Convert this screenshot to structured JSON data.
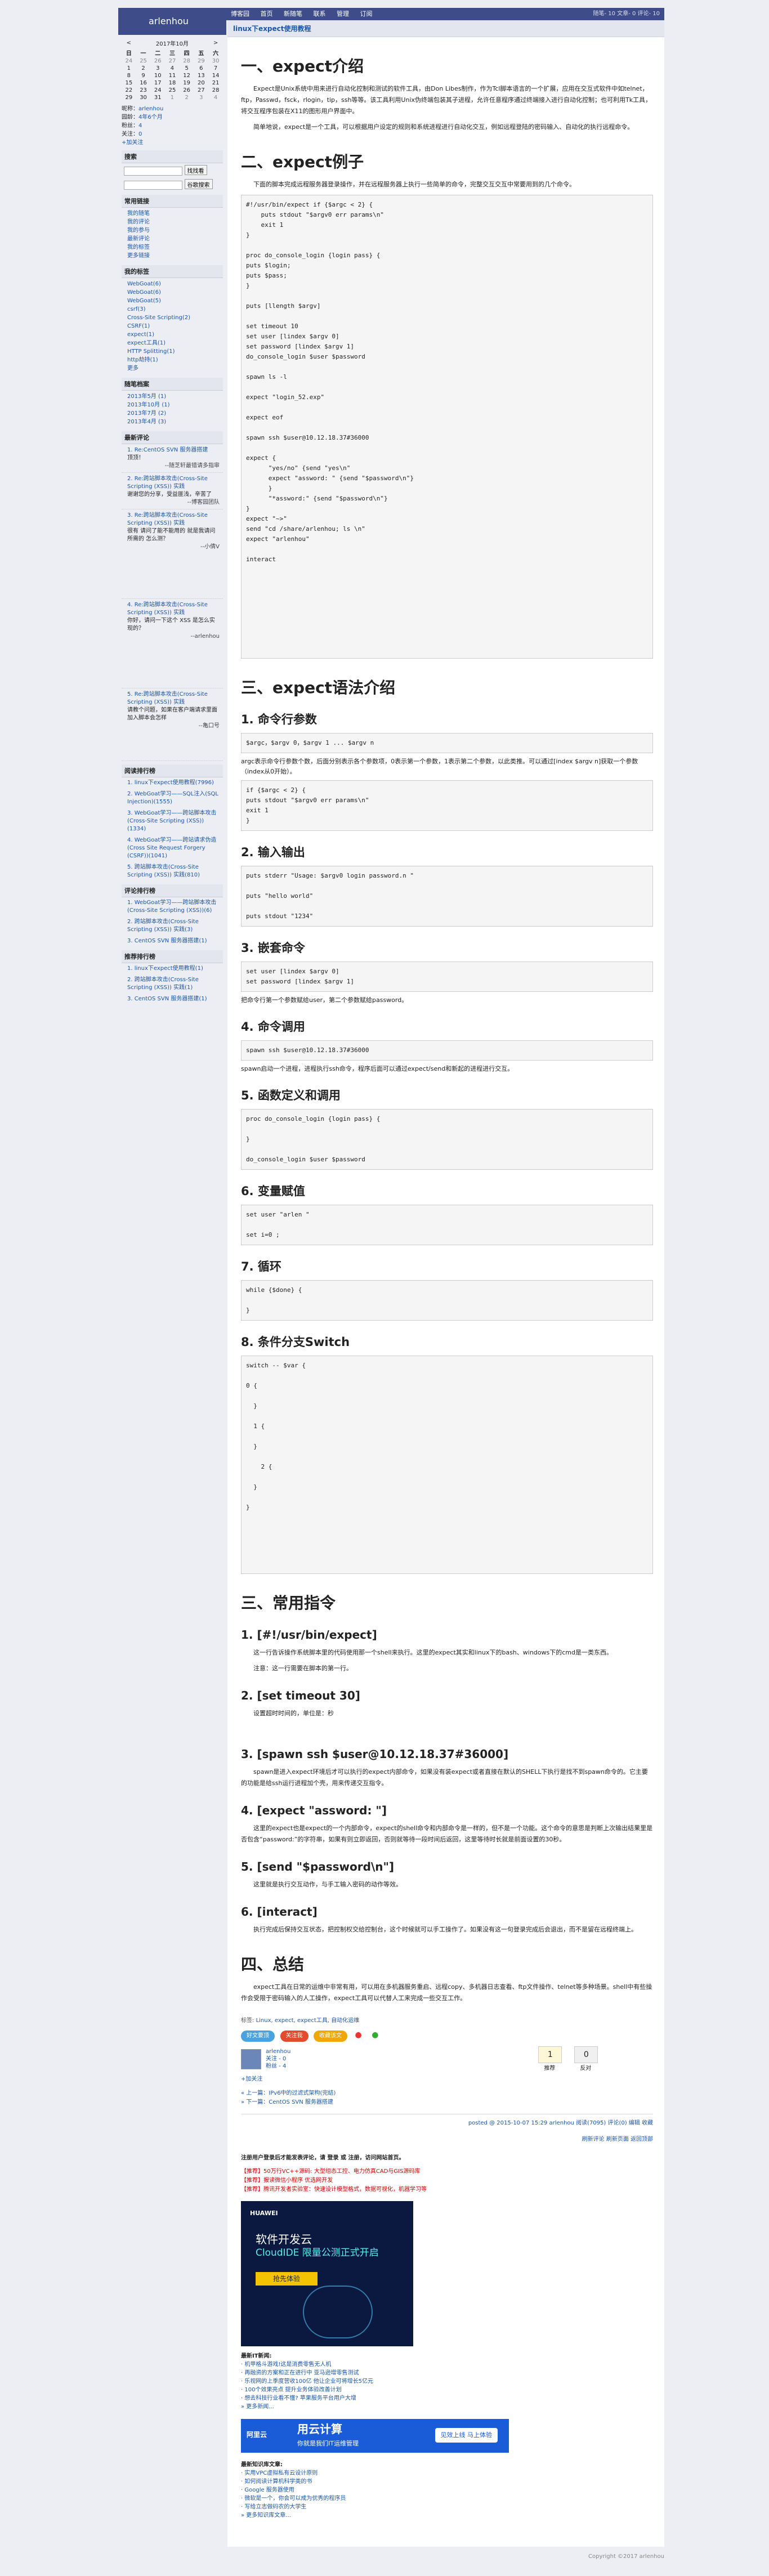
{
  "site": {
    "brand": "arlenhou",
    "nav": [
      "博客园",
      "首页",
      "新随笔",
      "联系",
      "管理",
      "订阅"
    ],
    "stats": "随笔- 10 文章- 0 评论- 10"
  },
  "calendar": {
    "prev": "<",
    "title": "2017年10月",
    "next": ">",
    "weekdays": [
      "日",
      "一",
      "二",
      "三",
      "四",
      "五",
      "六"
    ],
    "rows": [
      [
        "24",
        "25",
        "26",
        "27",
        "28",
        "29",
        "30"
      ],
      [
        "1",
        "2",
        "3",
        "4",
        "5",
        "6",
        "7"
      ],
      [
        "8",
        "9",
        "10",
        "11",
        "12",
        "13",
        "14"
      ],
      [
        "15",
        "16",
        "17",
        "18",
        "19",
        "20",
        "21"
      ],
      [
        "22",
        "23",
        "24",
        "25",
        "26",
        "27",
        "28"
      ],
      [
        "29",
        "30",
        "31",
        "1",
        "2",
        "3",
        "4"
      ]
    ]
  },
  "profile": {
    "nick_label": "昵称：",
    "nick": "arlenhou",
    "age_label": "园龄：",
    "age": "4年6个月",
    "fans_label": "粉丝：",
    "fans": "4",
    "follow_label": "关注：",
    "follow": "0",
    "add_follow": "+加关注"
  },
  "search": {
    "title": "搜索",
    "btn1": "找找看",
    "btn2": "谷歌搜索"
  },
  "links": {
    "title": "常用链接",
    "items": [
      "我的随笔",
      "我的评论",
      "我的参与",
      "最新评论",
      "我的标签",
      "更多链接"
    ]
  },
  "tags": {
    "title": "我的标签",
    "items": [
      "WebGoat(6)",
      "WebGoat(6)",
      "WebGoat(5)",
      "csrf(3)",
      "Cross-Site Scripting(2)",
      "CSRF(1)",
      "expect(1)",
      "expect工具(1)",
      "HTTP Splitting(1)",
      "http劫持(1)",
      "更多"
    ]
  },
  "archive": {
    "title": "随笔档案",
    "items": [
      "2013年5月 (1)",
      "2013年10月 (1)",
      "2013年7月 (2)",
      "2013年4月 (3)"
    ]
  },
  "recent_comments": {
    "title": "最新评论",
    "items": [
      {
        "link": "1. Re:CentOS SVN 服务器搭建",
        "text": "顶顶！",
        "by": "--随芝轩最错请多指审"
      },
      {
        "link": "2. Re:跨站脚本攻击(Cross-Site Scripting (XSS)) 实践",
        "text": "谢谢您的分享，受益匪浅，辛苦了",
        "by": "--博客园团队"
      },
      {
        "link": "3. Re:跨站脚本攻击(Cross-Site Scripting (XSS)) 实践",
        "text": "很有 请问了能不能用的 就是我请问所需的 怎么测？",
        "by": "--小倩V"
      },
      {
        "link": "4. Re:跨站脚本攻击(Cross-Site Scripting (XSS)) 实践",
        "text": "你好，请问一下这个 XSS 是怎么实现的？",
        "by": "--arlenhou"
      },
      {
        "link": "5. Re:跨站脚本攻击(Cross-Site Scripting (XSS)) 实践",
        "text": "请教个问题，如果在客户端请求里面加入脚本会怎样",
        "by": "--亀口号"
      }
    ]
  },
  "read_rank": {
    "title": "阅读排行榜",
    "items": [
      "1. linux下expect使用教程(7996)",
      "2. WebGoat学习——SQL注入(SQL Injection)(1555)",
      "3. WebGoat学习——跨站脚本攻击(Cross-Site Scripting (XSS))(1334)",
      "4. WebGoat学习——跨站请求伪造(Cross Site Request Forgery (CSRF))(1041)",
      "5. 跨站脚本攻击(Cross-Site Scripting (XSS)) 实践(810)"
    ]
  },
  "comment_rank": {
    "title": "评论排行榜",
    "items": [
      "1. WebGoat学习——跨站脚本攻击(Cross-Site Scripting (XSS))(6)",
      "2. 跨站脚本攻击(Cross-Site Scripting (XSS)) 实践(3)",
      "3. CentOS SVN 服务器搭建(1)"
    ]
  },
  "recommend_rank": {
    "title": "推荐排行榜",
    "items": [
      "1. linux下expect使用教程(1)",
      "2. 跨站脚本攻击(Cross-Site Scripting (XSS)) 实践(1)",
      "3. CentOS SVN 服务器搭建(1)"
    ]
  },
  "post": {
    "title": "linux下expect使用教程",
    "h_intro": "一、expect介绍",
    "intro_p1": "Expect是Unix系统中用来进行自动化控制和测试的软件工具，由Don Libes制作，作为Tcl脚本语言的一个扩展，应用在交互式软件中如telnet，ftp，Passwd，fsck，rlogin，tip，ssh等等。该工具利用Unix伪终端包装其子进程，允许任意程序通过终端接入进行自动化控制；也可利用Tk工具，将交互程序包装在X11的图形用户界面中。",
    "intro_p2": "简单地说，expect是一个工具，可以根据用户设定的规则和系统进程进行自动化交互，例如远程登陆的密码输入、自动化的执行远程命令。",
    "h_example": "二、expect例子",
    "example_p": "下面的脚本完成远程服务器登录操作，并在远程服务器上执行一些简单的命令，完整交互交互中常要用到的几个命令。",
    "h_syntax": "三、expect语法介绍",
    "h_s1": "1. 命令行参数",
    "s1_p": "$argc，$argv 0，$argv 1 ... $argv n",
    "s1_p2": "argc表示命令行参数个数，后面分别表示各个参数项，0表示第一个参数，1表示第二个参数，以此类推。可以通过[index $argv n]获取一个参数（index从0开始）。",
    "h_s2": "2. 输入输出",
    "h_s3": "3. 嵌套命令",
    "s3_p": "把命令行第一个参数赋给user，第二个参数赋给password。",
    "h_s4": "4. 命令调用",
    "s4_p": "spawn启动一个进程，进程执行ssh命令，程序后面可以通过expect/send和新起的进程进行交互。",
    "h_s5": "5. 函数定义和调用",
    "h_s6": "6. 变量赋值",
    "h_s7": "7. 循环",
    "h_s8": "8. 条件分支Switch",
    "h_cmds": "三、常用指令",
    "c1": "1. [#!/usr/bin/expect]",
    "c1_p": "这一行告诉操作系统脚本里的代码使用那一个shell来执行。这里的expect其实和linux下的bash、windows下的cmd是一类东西。",
    "c1_p2": "注意：这一行需要在脚本的第一行。",
    "c2": "2. [set timeout 30]",
    "c2_p": "设置超时时间的，单位是：秒",
    "c3": "3. [spawn ssh $user@10.12.18.37#36000]",
    "c3_p": "spawn是进入expect环境后才可以执行的expect内部命令，如果没有装expect或者直接在默认的SHELL下执行是找不到spawn命令的。它主要的功能是给ssh运行进程加个壳，用来传递交互指令。",
    "c4": "4. [expect \"assword: \"]",
    "c4_p": "这里的expect也是expect的一个内部命令，expect的shell命令和内部命令是一样的，但不是一个功能。这个命令的意思是判断上次输出结果里是否包含“password:”的字符串，如果有则立即返回，否则就等待一段时间后返回，这里等待时长就是前面设置的30秒。",
    "c5": "5. [send \"$password\\n\"]",
    "c5_p": "这里就是执行交互动作，与手工输入密码的动作等效。",
    "c6": "6. [interact]",
    "c6_p": "执行完成后保持交互状态，把控制权交给控制台，这个时候就可以手工操作了。如果没有这一句登录完成后会退出，而不是留在远程终端上。",
    "h_sum": "四、总结",
    "sum_p": "expect工具在日常的运维中非常有用，可以用在多机器服务重启、远程copy、多机器日志查看、ftp文件操作、telnet等多种场景。shell中有些操作会受限于密码输入的人工操作，expect工具可以代替人工来完成一些交互工作。"
  },
  "code": {
    "ex1": [
      "#!/usr/bin/expect if {$argc < 2} {",
      "    puts stdout \"$argv0 err params\\n\"",
      "    exit 1",
      "}",
      "",
      "proc do_console_login {login pass} {",
      "puts $login;",
      "puts $pass;",
      "}",
      "",
      "puts [llength $argv]",
      "",
      "set timeout 10",
      "set user [lindex $argv 0]",
      "set password [lindex $argv 1]",
      "do_console_login $user $password",
      "",
      "spawn ls -l",
      "",
      "expect \"login_52.exp\"",
      "",
      "expect eof",
      "",
      "spawn ssh $user@10.12.18.37#36000",
      "",
      "expect {",
      "      \"yes/no\" {send \"yes\\n\"",
      "      expect \"assword: \" {send \"$password\\n\"}",
      "      }",
      "      \"*assword:\" {send \"$password\\n\"}",
      "}",
      "expect \"~>\"",
      "send \"cd /share/arlenhou; ls \\n\"",
      "expect \"arlenhou\"",
      "",
      "interact"
    ],
    "s1": [
      "if {$argc < 2} {",
      "puts stdout \"$argv0 err params\\n\"",
      "exit 1",
      "}"
    ],
    "s2": [
      "puts stderr \"Usage: $argv0 login password.n \"",
      "",
      "puts \"hello world\"",
      "",
      "puts stdout \"1234\""
    ],
    "s3": [
      "set user [lindex $argv 0]",
      "set password [lindex $argv 1]"
    ],
    "s4": [
      "spawn ssh $user@10.12.18.37#36000"
    ],
    "s5": [
      "proc do_console_login {login pass} {",
      "",
      "}",
      "",
      "do_console_login $user $password"
    ],
    "s6": [
      "set user \"arlen \"",
      "",
      "set i=0 ;"
    ],
    "s7": [
      "while {$done} {",
      "",
      "}"
    ],
    "s8": [
      "switch -- $var {",
      "",
      "0 {",
      "",
      "  }",
      "",
      "  1 {",
      "",
      "  }",
      "",
      "    2 {",
      "",
      "  }",
      "",
      "}"
    ]
  },
  "footer_post": {
    "tags_label": "标签:",
    "tags": "Linux, expect, expect工具, 自动化运维",
    "share": [
      "好文要顶",
      "关注我",
      "收藏该文"
    ],
    "share_colors": [
      "#4aa3df",
      "#e44b2e",
      "#f0a700"
    ],
    "author": "arlenhou",
    "author_follow": "关注 - 0",
    "author_fans": "粉丝 - 4",
    "add_follow": "+加关注",
    "up_count": "1",
    "up_label": "推荐",
    "down_count": "0",
    "down_label": "反对",
    "prev": "« 上一篇：IPv6中的过滤式架构(完结)",
    "next": "» 下一篇：CentOS SVN 服务器搭建",
    "posted": "posted @ 2015-10-07 15:29 arlenhou 阅读(7095) 评论(0) 编辑 收藏",
    "links_row": "刷新评论  刷新页面  返回顶部",
    "login_prompt": "注册用户登录后才能发表评论，请 登录 或 注册，访问网站首页。",
    "promo1": "【推荐】50万行VC++源码: 大型组态工控、电力仿真CAD与GIS源码库",
    "promo2": "【推荐】报读微信小程序 优选网开发",
    "promo3": "【推荐】腾讯开发者实验室：快速设计模型格式，数据可视化，机器学习等",
    "news_title": "最新IT新闻:",
    "news": [
      "· 机甲格斗游戏!这是消费零售无人机",
      "· 再融资的方案和正在进行中 亚马逊增零售测试",
      "· 乐视网的上季度营收100亿 他让企业可将增长5亿元",
      "· 100个效果亮点 提升业务体验改善计划",
      "· 想去科技行业看不懂? 苹果服务平台用户大增",
      "» 更多新闻..."
    ],
    "kb_title": "最新知识库文章:",
    "kb": [
      "· 实用VPC虚拟私有云设计原则",
      "· 如何阅读计算机科学类的书",
      "· Google 服务器使用",
      "· 微软是一个，你会可以成为优秀的程序员",
      "· 写给立志做码农的大学生",
      "» 更多知识库文章..."
    ],
    "ad1_brand": "HUAWEI",
    "ad1_l1": "软件开发云",
    "ad1_l2": "CloudIDE 限量公测正式开启",
    "ad1_btn": "抢先体验",
    "ad2_logo": "阿里云",
    "ad2_big": "用云计算",
    "ad2_small": "你就是我们IT运维管理",
    "ad2_go": "见效上线 马上体验"
  },
  "copyright": "Copyright ©2017 arlenhou"
}
